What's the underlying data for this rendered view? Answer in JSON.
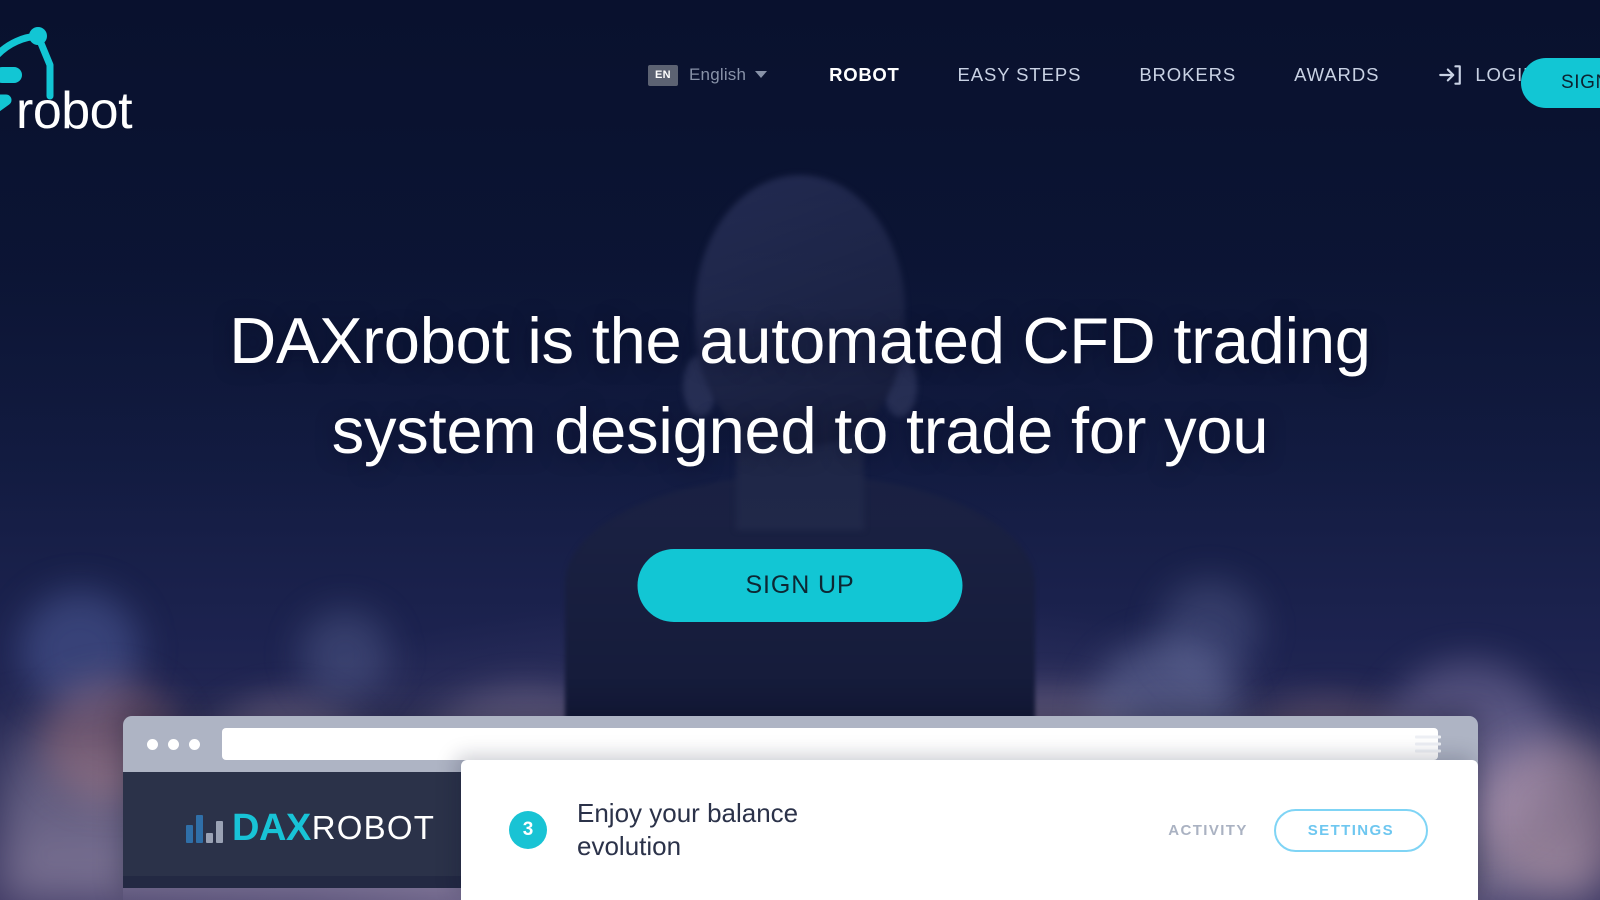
{
  "brand": {
    "logo_text": "robot",
    "logo_full": "DAXrobot",
    "logo_mark_icon": "robot-antenna-icon",
    "accent_cyan": "#12c6d4",
    "dark_navy": "#0a1330",
    "app_header_bg": "#2b3249"
  },
  "nav": {
    "lang_badge": "EN",
    "lang_name": "English",
    "caret_icon": "chevron-down-icon",
    "items": [
      {
        "label": "ROBOT",
        "active": true
      },
      {
        "label": "EASY STEPS",
        "active": false
      },
      {
        "label": "BROKERS",
        "active": false
      },
      {
        "label": "AWARDS",
        "active": false
      }
    ],
    "login_label": "LOGIN",
    "login_icon": "sign-in-arrow-icon",
    "signup_label": "SIGN UP"
  },
  "hero": {
    "headline_line1": "DAXrobot is the automated CFD trading",
    "headline_line2": "system designed to trade for you",
    "cta_label": "SIGN UP",
    "background_icon": "businessman-silhouette-city-bokeh"
  },
  "browser": {
    "url_value": "",
    "url_placeholder": "",
    "dots_icon": "window-dots-icon",
    "menu_icon": "hamburger-menu-icon",
    "app": {
      "logo_mark_icon": "bar-chart-logo-icon",
      "logo_dax": "DAX",
      "logo_robot": "ROBOT"
    }
  },
  "step_card": {
    "number": "3",
    "text": "Enjoy your balance evolution",
    "activity_label": "ACTIVITY",
    "settings_label": "SETTINGS"
  }
}
